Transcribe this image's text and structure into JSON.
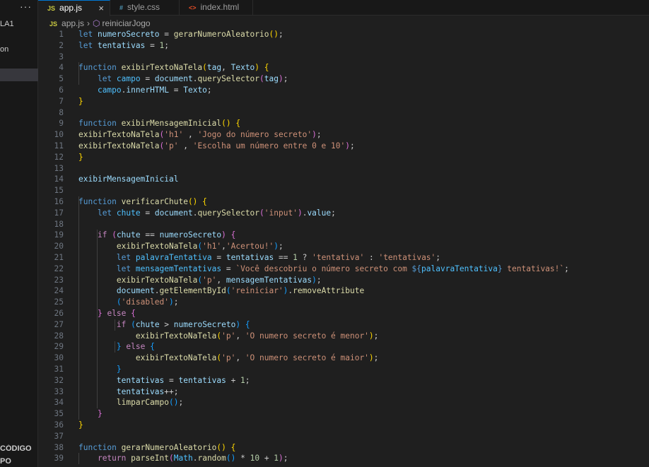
{
  "sidebar": {
    "menu_glyph": "···",
    "items": [
      "LA1",
      "on"
    ],
    "bottom_items": [
      "CÓDIGO",
      "PO"
    ]
  },
  "tabs": [
    {
      "label": "app.js",
      "icon": "JS",
      "icon_color": "#cbcb41",
      "active": true,
      "close": "×"
    },
    {
      "label": "style.css",
      "icon": "#",
      "icon_color": "#519aba",
      "active": false
    },
    {
      "label": "index.html",
      "icon": "<>",
      "icon_color": "#e44d26",
      "active": false
    }
  ],
  "breadcrumb": {
    "file": "app.js",
    "symbol": "reiniciarJogo"
  },
  "code": [
    [
      [
        "k",
        "let"
      ],
      [
        "p",
        " "
      ],
      [
        "v",
        "numeroSecreto"
      ],
      [
        "p",
        " = "
      ],
      [
        "f",
        "gerarNumeroAleatorio"
      ],
      [
        "b1",
        "()"
      ],
      [
        "p",
        ";"
      ]
    ],
    [
      [
        "k",
        "let"
      ],
      [
        "p",
        " "
      ],
      [
        "v",
        "tentativas"
      ],
      [
        "p",
        " = "
      ],
      [
        "n",
        "1"
      ],
      [
        "p",
        ";"
      ]
    ],
    [],
    [
      [
        "k",
        "function"
      ],
      [
        "p",
        " "
      ],
      [
        "f",
        "exibirTextoNaTela"
      ],
      [
        "b1",
        "("
      ],
      [
        "v",
        "tag"
      ],
      [
        "p",
        ", "
      ],
      [
        "v",
        "Texto"
      ],
      [
        "b1",
        ")"
      ],
      [
        "p",
        " "
      ],
      [
        "b1",
        "{"
      ]
    ],
    [
      [
        "p",
        "    "
      ],
      [
        "k",
        "let"
      ],
      [
        "p",
        " "
      ],
      [
        "c",
        "campo"
      ],
      [
        "p",
        " = "
      ],
      [
        "v",
        "document"
      ],
      [
        "p",
        "."
      ],
      [
        "f",
        "querySelector"
      ],
      [
        "b2",
        "("
      ],
      [
        "v",
        "tag"
      ],
      [
        "b2",
        ")"
      ],
      [
        "p",
        ";"
      ]
    ],
    [
      [
        "p",
        "    "
      ],
      [
        "c",
        "campo"
      ],
      [
        "p",
        "."
      ],
      [
        "v",
        "innerHTML"
      ],
      [
        "p",
        " = "
      ],
      [
        "v",
        "Texto"
      ],
      [
        "p",
        ";"
      ]
    ],
    [
      [
        "b1",
        "}"
      ]
    ],
    [],
    [
      [
        "k",
        "function"
      ],
      [
        "p",
        " "
      ],
      [
        "f",
        "exibirMensagemInicial"
      ],
      [
        "b1",
        "()"
      ],
      [
        "p",
        " "
      ],
      [
        "b1",
        "{"
      ]
    ],
    [
      [
        "f",
        "exibirTextoNaTela"
      ],
      [
        "b2",
        "("
      ],
      [
        "s",
        "'h1'"
      ],
      [
        "p",
        " , "
      ],
      [
        "s",
        "'Jogo do número secreto'"
      ],
      [
        "b2",
        ")"
      ],
      [
        "p",
        ";"
      ]
    ],
    [
      [
        "f",
        "exibirTextoNaTela"
      ],
      [
        "b2",
        "("
      ],
      [
        "s",
        "'p'"
      ],
      [
        "p",
        " , "
      ],
      [
        "s",
        "'Escolha um número entre 0 e 10'"
      ],
      [
        "b2",
        ")"
      ],
      [
        "p",
        ";"
      ]
    ],
    [
      [
        "b1",
        "}"
      ]
    ],
    [],
    [
      [
        "v",
        "exibirMensagemInicial"
      ]
    ],
    [],
    [
      [
        "k",
        "function"
      ],
      [
        "p",
        " "
      ],
      [
        "f",
        "verificarChute"
      ],
      [
        "b1",
        "()"
      ],
      [
        "p",
        " "
      ],
      [
        "b1",
        "{"
      ]
    ],
    [
      [
        "p",
        "    "
      ],
      [
        "k",
        "let"
      ],
      [
        "p",
        " "
      ],
      [
        "c",
        "chute"
      ],
      [
        "p",
        " = "
      ],
      [
        "v",
        "document"
      ],
      [
        "p",
        "."
      ],
      [
        "f",
        "querySelector"
      ],
      [
        "b2",
        "("
      ],
      [
        "s",
        "'input'"
      ],
      [
        "b2",
        ")"
      ],
      [
        "p",
        "."
      ],
      [
        "v",
        "value"
      ],
      [
        "p",
        ";"
      ]
    ],
    [],
    [
      [
        "p",
        "    "
      ],
      [
        "kc",
        "if"
      ],
      [
        "p",
        " "
      ],
      [
        "b2",
        "("
      ],
      [
        "v",
        "chute"
      ],
      [
        "p",
        " == "
      ],
      [
        "v",
        "numeroSecreto"
      ],
      [
        "b2",
        ")"
      ],
      [
        "p",
        " "
      ],
      [
        "b2",
        "{"
      ]
    ],
    [
      [
        "p",
        "        "
      ],
      [
        "f",
        "exibirTextoNaTela"
      ],
      [
        "b3",
        "("
      ],
      [
        "s",
        "'h1'"
      ],
      [
        "p",
        ","
      ],
      [
        "s",
        "'Acertou!'"
      ],
      [
        "b3",
        ")"
      ],
      [
        "p",
        ";"
      ]
    ],
    [
      [
        "p",
        "        "
      ],
      [
        "k",
        "let"
      ],
      [
        "p",
        " "
      ],
      [
        "c",
        "palavraTentativa"
      ],
      [
        "p",
        " = "
      ],
      [
        "v",
        "tentativas"
      ],
      [
        "p",
        " == "
      ],
      [
        "n",
        "1"
      ],
      [
        "p",
        " ? "
      ],
      [
        "s",
        "'tentativa'"
      ],
      [
        "p",
        " : "
      ],
      [
        "s",
        "'tentativas'"
      ],
      [
        "p",
        ";"
      ]
    ],
    [
      [
        "p",
        "        "
      ],
      [
        "k",
        "let"
      ],
      [
        "p",
        " "
      ],
      [
        "c",
        "mensagemTentativas"
      ],
      [
        "p",
        " = "
      ],
      [
        "s",
        "`Você descobriu o número secreto com "
      ],
      [
        "k",
        "${"
      ],
      [
        "c",
        "palavraTentativa"
      ],
      [
        "k",
        "}"
      ],
      [
        "s",
        " tentativas!`"
      ],
      [
        "p",
        ";"
      ]
    ],
    [
      [
        "p",
        "        "
      ],
      [
        "f",
        "exibirTextoNaTela"
      ],
      [
        "b3",
        "("
      ],
      [
        "s",
        "'p'"
      ],
      [
        "p",
        ", "
      ],
      [
        "v",
        "mensagemTentativas"
      ],
      [
        "b3",
        ")"
      ],
      [
        "p",
        ";"
      ]
    ],
    [
      [
        "p",
        "        "
      ],
      [
        "v",
        "document"
      ],
      [
        "p",
        "."
      ],
      [
        "f",
        "getElementById"
      ],
      [
        "b3",
        "("
      ],
      [
        "s",
        "'reiniciar'"
      ],
      [
        "b3",
        ")"
      ],
      [
        "p",
        "."
      ],
      [
        "f",
        "removeAttribute"
      ]
    ],
    [
      [
        "p",
        "        "
      ],
      [
        "b3",
        "("
      ],
      [
        "s",
        "'disabled'"
      ],
      [
        "b3",
        ")"
      ],
      [
        "p",
        ";"
      ]
    ],
    [
      [
        "p",
        "    "
      ],
      [
        "b2",
        "}"
      ],
      [
        "p",
        " "
      ],
      [
        "kc",
        "else"
      ],
      [
        "p",
        " "
      ],
      [
        "b2",
        "{"
      ]
    ],
    [
      [
        "p",
        "        "
      ],
      [
        "kc",
        "if"
      ],
      [
        "p",
        " "
      ],
      [
        "b3",
        "("
      ],
      [
        "v",
        "chute"
      ],
      [
        "p",
        " > "
      ],
      [
        "v",
        "numeroSecreto"
      ],
      [
        "b3",
        ")"
      ],
      [
        "p",
        " "
      ],
      [
        "b3",
        "{"
      ]
    ],
    [
      [
        "p",
        "            "
      ],
      [
        "f",
        "exibirTextoNaTela"
      ],
      [
        "b1",
        "("
      ],
      [
        "s",
        "'p'"
      ],
      [
        "p",
        ", "
      ],
      [
        "s",
        "'O numero secreto é menor'"
      ],
      [
        "b1",
        ")"
      ],
      [
        "p",
        ";"
      ]
    ],
    [
      [
        "p",
        "        "
      ],
      [
        "b3",
        "}"
      ],
      [
        "p",
        " "
      ],
      [
        "kc",
        "else"
      ],
      [
        "p",
        " "
      ],
      [
        "b3",
        "{"
      ]
    ],
    [
      [
        "p",
        "            "
      ],
      [
        "f",
        "exibirTextoNaTela"
      ],
      [
        "b1",
        "("
      ],
      [
        "s",
        "'p'"
      ],
      [
        "p",
        ", "
      ],
      [
        "s",
        "'O numero secreto é maior'"
      ],
      [
        "b1",
        ")"
      ],
      [
        "p",
        ";"
      ]
    ],
    [
      [
        "p",
        "        "
      ],
      [
        "b3",
        "}"
      ]
    ],
    [
      [
        "p",
        "        "
      ],
      [
        "v",
        "tentativas"
      ],
      [
        "p",
        " = "
      ],
      [
        "v",
        "tentativas"
      ],
      [
        "p",
        " + "
      ],
      [
        "n",
        "1"
      ],
      [
        "p",
        ";"
      ]
    ],
    [
      [
        "p",
        "        "
      ],
      [
        "v",
        "tentativas"
      ],
      [
        "p",
        "++;"
      ]
    ],
    [
      [
        "p",
        "        "
      ],
      [
        "f",
        "limparCampo"
      ],
      [
        "b3",
        "()"
      ],
      [
        "p",
        ";"
      ]
    ],
    [
      [
        "p",
        "    "
      ],
      [
        "b2",
        "}"
      ]
    ],
    [
      [
        "b1",
        "}"
      ]
    ],
    [],
    [
      [
        "k",
        "function"
      ],
      [
        "p",
        " "
      ],
      [
        "f",
        "gerarNumeroAleatorio"
      ],
      [
        "b1",
        "()"
      ],
      [
        "p",
        " "
      ],
      [
        "b1",
        "{"
      ]
    ],
    [
      [
        "p",
        "    "
      ],
      [
        "kc",
        "return"
      ],
      [
        "p",
        " "
      ],
      [
        "f",
        "parseInt"
      ],
      [
        "b2",
        "("
      ],
      [
        "c",
        "Math"
      ],
      [
        "p",
        "."
      ],
      [
        "f",
        "random"
      ],
      [
        "b3",
        "()"
      ],
      [
        "p",
        " * "
      ],
      [
        "n",
        "10"
      ],
      [
        "p",
        " + "
      ],
      [
        "n",
        "1"
      ],
      [
        "b2",
        ")"
      ],
      [
        "p",
        ";"
      ]
    ]
  ]
}
